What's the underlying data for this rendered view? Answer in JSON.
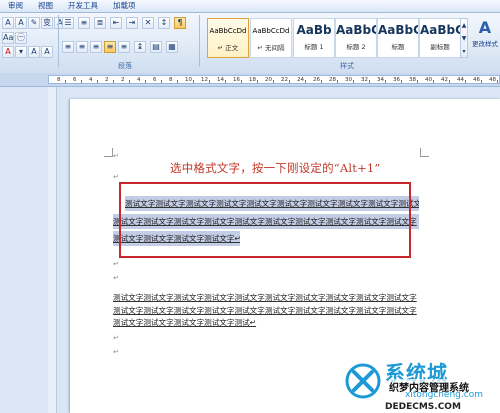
{
  "menubar": {
    "tabs": [
      "审阅",
      "视图",
      "开发工具",
      "加载项"
    ]
  },
  "ribbon": {
    "paragraph_group_label": "段落",
    "styles_group_label": "样式",
    "styles": [
      {
        "sample": "AaBbCcDd",
        "name": "↵ 正文",
        "selected": true
      },
      {
        "sample": "AaBbCcDd",
        "name": "↵ 无间隔",
        "selected": false
      },
      {
        "sample": "AaBb",
        "name": "标题 1",
        "selected": false
      },
      {
        "sample": "AaBbC",
        "name": "标题 2",
        "selected": false
      },
      {
        "sample": "AaBbC",
        "name": "标题",
        "selected": false
      },
      {
        "sample": "AaBbC",
        "name": "副标题",
        "selected": false
      }
    ],
    "change_styles": {
      "glyph": "A",
      "label": "更改样式"
    }
  },
  "ruler": {
    "numbers": [
      "8",
      "6",
      "4",
      "2",
      "2",
      "4",
      "6",
      "8",
      "10",
      "12",
      "14",
      "16",
      "18",
      "20",
      "22",
      "24",
      "26",
      "28",
      "30",
      "32",
      "34",
      "36",
      "38",
      "40",
      "42",
      "44",
      "46",
      "48"
    ]
  },
  "document": {
    "paragraph_mark": "↵",
    "title": "选中格式文字，按一下刚设定的“Alt+1”",
    "selected_lines": [
      "测试文字测试文字测试文字测试文字测试文字测试文字测试文字测试文字测试文字测试文字",
      "测试文字测试文字测试文字测试文字测试文字测试文字测试文字测试文字测试文字测试文字",
      "测试文字测试文字测试文字测试文字↵"
    ],
    "body_lines": [
      "测试文字测试文字测试文字测试文字测试文字测试文字测试文字测试文字测试文字测试文字",
      "测试文字测试文字测试文字测试文字测试文字测试文字测试文字测试文字测试文字测试文字",
      "测试文字测试文字测试文字测试文字测试↵"
    ]
  },
  "watermark": {
    "brand": "系统城",
    "slogan": "织梦内容管理系统",
    "url_top": "xitongcheng.com",
    "url_bottom": "DEDECMS.COM"
  }
}
